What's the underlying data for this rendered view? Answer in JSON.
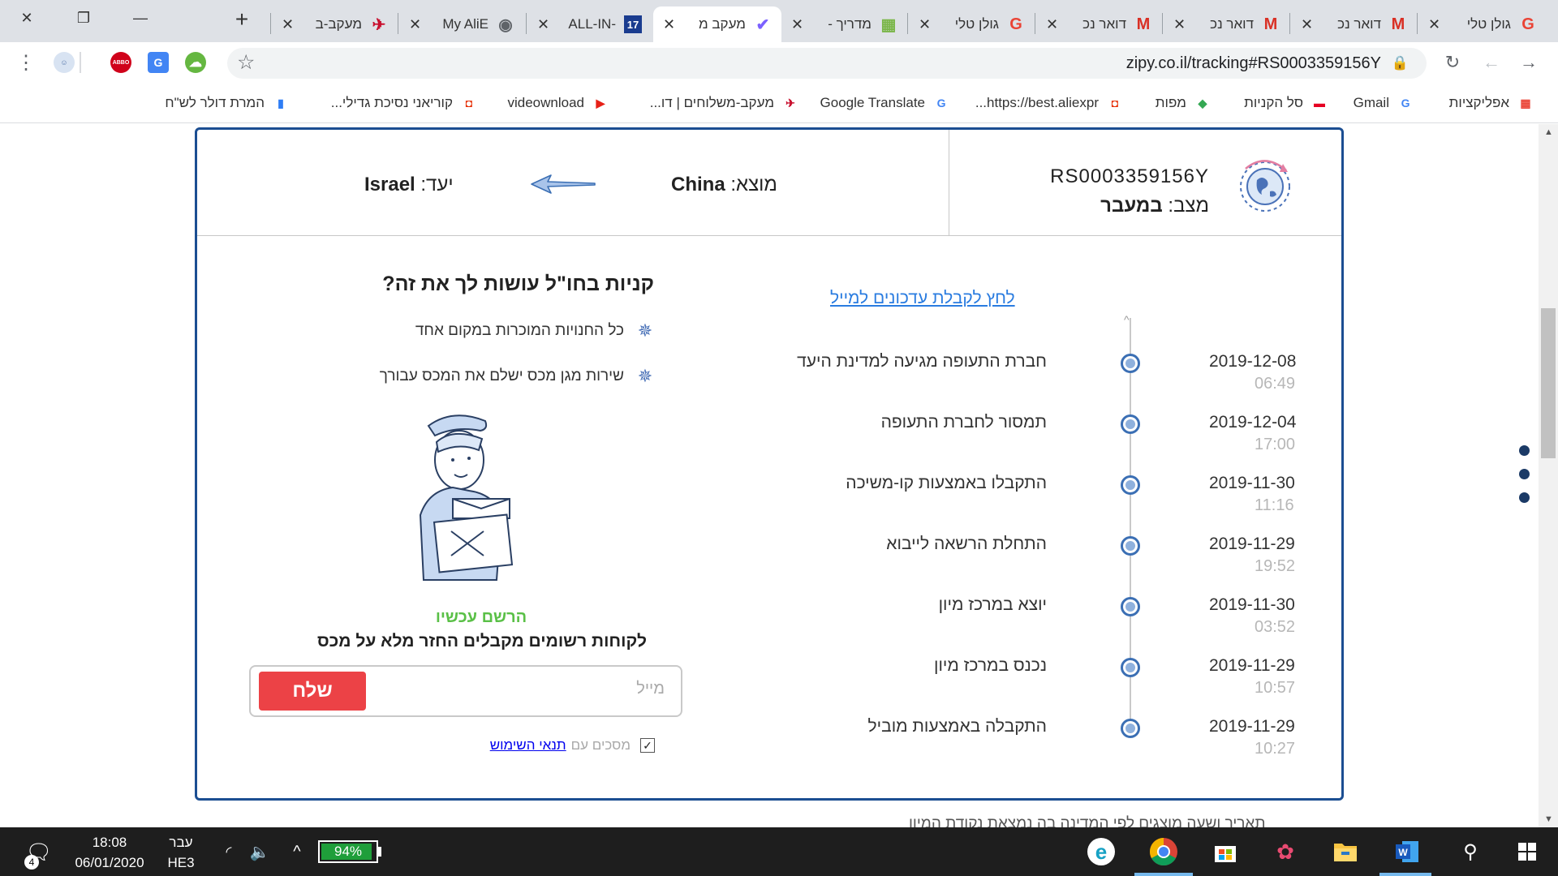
{
  "browser": {
    "tabs": [
      {
        "label": "גולן טלי",
        "icon": "G",
        "icon_color": "#ea4335",
        "active": false
      },
      {
        "label": "דואר נכ",
        "icon": "M",
        "icon_color": "#d93025",
        "active": false
      },
      {
        "label": "דואר נכ",
        "icon": "M",
        "icon_color": "#d93025",
        "active": false
      },
      {
        "label": "דואר נכ",
        "icon": "M",
        "icon_color": "#d93025",
        "active": false
      },
      {
        "label": "גולן טלי",
        "icon": "G",
        "icon_color": "#ea4335",
        "active": false
      },
      {
        "label": "מדריך -",
        "icon": "▦",
        "icon_color": "#7ab648",
        "active": false
      },
      {
        "label": "מעקב מ",
        "icon": "✔",
        "icon_color": "#7b61ff",
        "active": true
      },
      {
        "label": "ALL-IN-",
        "icon": "17",
        "icon_color": "#1a3c8f",
        "active": false
      },
      {
        "label": "My AliE",
        "icon": "◉",
        "icon_color": "#5f6368",
        "active": false
      },
      {
        "label": "מעקב-ב",
        "icon": "✈",
        "icon_color": "#c8102e",
        "active": false
      }
    ],
    "url": "zipy.co.il/tracking#RS0003359156Y",
    "bookmarks": [
      {
        "label": "אפליקציות",
        "icon": "▦",
        "icon_color": "#ea4335"
      },
      {
        "label": "Gmail",
        "icon": "G",
        "icon_color": "#4285f4"
      },
      {
        "label": "סל הקניות",
        "icon": "▬",
        "icon_color": "#e60023"
      },
      {
        "label": "מפות",
        "icon": "◆",
        "icon_color": "#34a853"
      },
      {
        "label": "https://best.aliexpr...",
        "icon": "◘",
        "icon_color": "#e62e04"
      },
      {
        "label": "Google Translate",
        "icon": "G",
        "icon_color": "#4285f4"
      },
      {
        "label": "מעקב-משלוחים | דו...",
        "icon": "✈",
        "icon_color": "#c8102e"
      },
      {
        "label": "videownload",
        "icon": "▶",
        "icon_color": "#e62117"
      },
      {
        "label": "קוריאני נסיכת גדילי...",
        "icon": "◘",
        "icon_color": "#e62e04"
      },
      {
        "label": "המרת דולר לש\"ח",
        "icon": "▮",
        "icon_color": "#2e7df5"
      }
    ]
  },
  "tracking": {
    "number": "RS0003359156Y",
    "status_label": "מצב:",
    "status_value": "במעבר",
    "origin_label": "מוצא:",
    "origin_value": "China",
    "dest_label": "יעד:",
    "dest_value": "Israel",
    "email_updates_link": "לחץ לקבלת עדכונים למייל",
    "events": [
      {
        "date": "2019-12-08",
        "time": "06:49",
        "desc": "חברת התעופה מגיעה למדינת היעד"
      },
      {
        "date": "2019-12-04",
        "time": "17:00",
        "desc": "תמסור לחברת התעופה"
      },
      {
        "date": "2019-11-30",
        "time": "11:16",
        "desc": "התקבלו באמצעות קו-משיכה"
      },
      {
        "date": "2019-11-29",
        "time": "19:52",
        "desc": "התחלת הרשאה לייבוא"
      },
      {
        "date": "2019-11-30",
        "time": "03:52",
        "desc": "יוצא במרכז מיון"
      },
      {
        "date": "2019-11-29",
        "time": "10:57",
        "desc": "נכנס במרכז מיון"
      },
      {
        "date": "2019-11-29",
        "time": "10:27",
        "desc": "התקבלה באמצעות מוביל"
      }
    ]
  },
  "promo": {
    "title": "קניות בחו\"ל עושות לך את זה?",
    "bullets": [
      "כל החנויות המוכרות במקום אחד",
      "שירות מגן מכס ישלם את המכס עבורך"
    ],
    "register_now": "הרשם עכשיו",
    "refund_text": "לקוחות רשומים מקבלים החזר מלא על מכס",
    "email_placeholder": "מייל",
    "send_label": "שלח",
    "agree_text": "מסכים עם",
    "terms_link": "תנאי השימוש"
  },
  "below_text": "תאריך ושעה מוצגים לפי המדינה בה נמצאת נקודת המיון",
  "taskbar": {
    "time": "18:08",
    "date": "06/01/2020",
    "lang_top": "עבר",
    "lang_bottom": "HE3",
    "battery": "94%",
    "battery_level": 0.94,
    "notifications": "4"
  },
  "colors": {
    "card_border": "#1b4e92",
    "send_button": "#ec4246",
    "register_green": "#5ac047",
    "link_blue": "#2a7ce0"
  }
}
